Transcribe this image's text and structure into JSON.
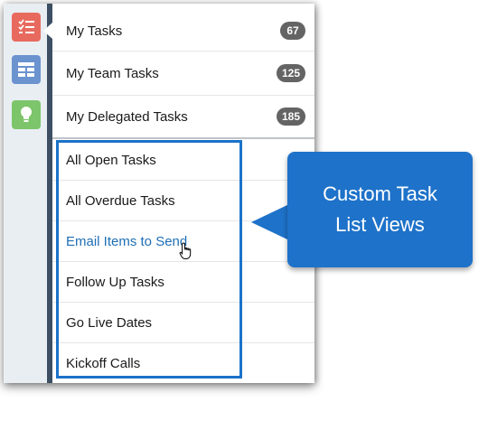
{
  "rail": {
    "icons": [
      "task-list-icon",
      "table-grid-icon",
      "lightbulb-icon"
    ],
    "colors": {
      "tasks": "#e86a5f",
      "table": "#6b93cf",
      "idea": "#7cc56a"
    }
  },
  "menu": {
    "items": [
      {
        "label": "My Tasks",
        "count": "67"
      },
      {
        "label": "My Team Tasks",
        "count": "125"
      },
      {
        "label": "My Delegated Tasks",
        "count": "185"
      }
    ],
    "custom_views": [
      {
        "label": "All Open Tasks"
      },
      {
        "label": "All Overdue Tasks"
      },
      {
        "label": "Email Items to Send"
      },
      {
        "label": "Follow Up Tasks"
      },
      {
        "label": "Go Live Dates"
      },
      {
        "label": "Kickoff Calls"
      }
    ]
  },
  "callout": {
    "line1": "Custom Task",
    "line2": "List Views"
  },
  "colors": {
    "highlight": "#1b72c9",
    "link": "#1f6fb5",
    "badge": "#646464"
  }
}
